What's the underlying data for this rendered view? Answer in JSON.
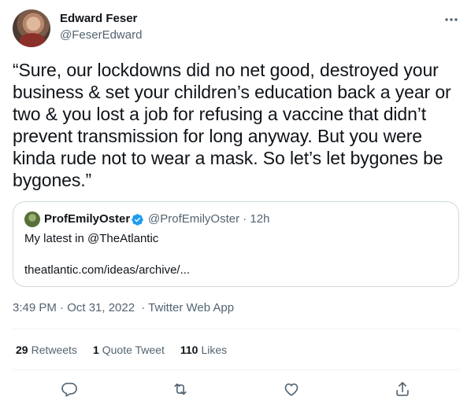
{
  "author": {
    "name": "Edward Feser",
    "handle": "@FeserEdward"
  },
  "tweet": {
    "text": "“Sure, our lockdowns did no net good, destroyed your business & set your children’s education back a year or two & you lost a job for refusing a vaccine that didn’t prevent transmission for long anyway. But you were kinda rude not to wear a mask. So let’s let bygones be bygones.”"
  },
  "quote": {
    "name": "ProfEmilyOster",
    "handle_time": "@ProfEmilyOster · 12h",
    "text": "My latest in @TheAtlantic",
    "link": "theatlantic.com/ideas/archive/..."
  },
  "meta": {
    "time": "3:49 PM · Oct 31, 2022",
    "source": "· Twitter Web App"
  },
  "stats": {
    "retweets_count": "29",
    "retweets_label": "Retweets",
    "quotes_count": "1",
    "quotes_label": "Quote Tweet",
    "likes_count": "110",
    "likes_label": "Likes"
  },
  "icons": {
    "more": "more-horizontal-icon",
    "verified": "verified-badge-icon",
    "reply": "reply-icon",
    "retweet": "retweet-icon",
    "like": "heart-icon",
    "share": "share-icon"
  },
  "colors": {
    "text": "#0f1419",
    "secondary": "#536471",
    "verified": "#1d9bf0",
    "border": "#cfd9de"
  }
}
